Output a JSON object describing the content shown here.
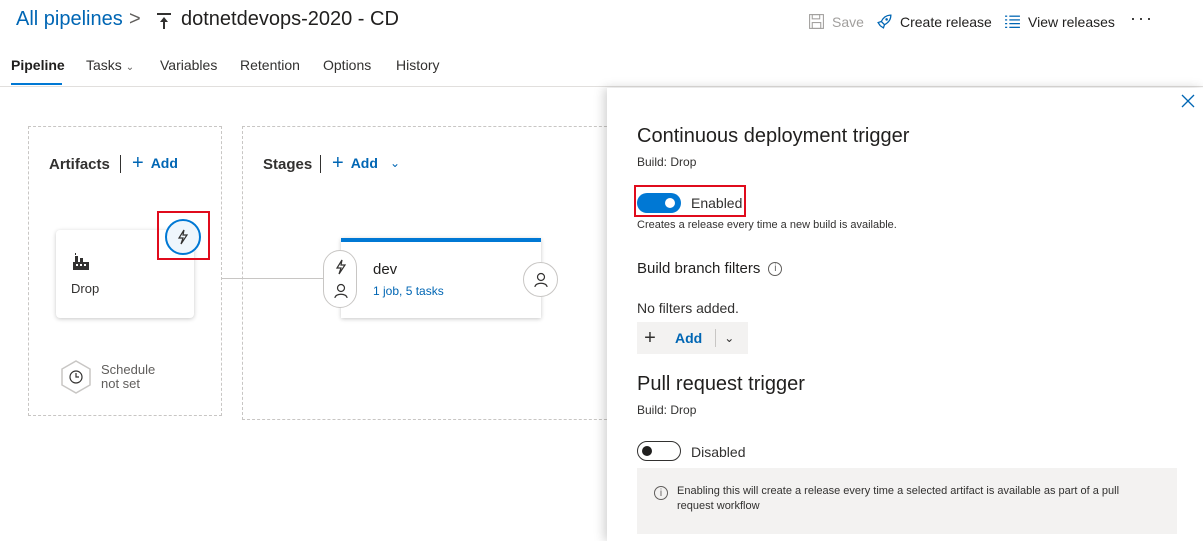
{
  "header": {
    "breadcrumb_root": "All pipelines",
    "breadcrumb_sep": ">",
    "pipeline_name": "dotnetdevops-2020 - CD",
    "save_label": "Save",
    "create_release_label": "Create release",
    "view_releases_label": "View releases",
    "more_label": "···"
  },
  "tabs": [
    {
      "label": "Pipeline",
      "active": true
    },
    {
      "label": "Tasks"
    },
    {
      "label": "Variables"
    },
    {
      "label": "Retention"
    },
    {
      "label": "Options"
    },
    {
      "label": "History"
    }
  ],
  "canvas": {
    "artifacts_title": "Artifacts",
    "artifacts_add": "Add",
    "artifact_name": "Drop",
    "schedule_text": "Schedule not set",
    "stages_title": "Stages",
    "stages_add": "Add",
    "stage": {
      "name": "dev",
      "summary": "1 job, 5 tasks"
    }
  },
  "panel": {
    "cd_title": "Continuous deployment trigger",
    "cd_build": "Build: Drop",
    "cd_toggle_label": "Enabled",
    "cd_toggle_on": true,
    "cd_desc": "Creates a release every time a new build is available.",
    "branch_filters_title": "Build branch filters",
    "no_filters": "No filters added.",
    "add_label": "Add",
    "pr_title": "Pull request trigger",
    "pr_build": "Build: Drop",
    "pr_toggle_label": "Disabled",
    "pr_toggle_on": false,
    "pr_info": "Enabling this will create a release every time a selected artifact is available as part of a pull request workflow"
  },
  "colors": {
    "accent": "#0078d4",
    "link": "#0066b4",
    "highlight": "#e00b1c"
  }
}
